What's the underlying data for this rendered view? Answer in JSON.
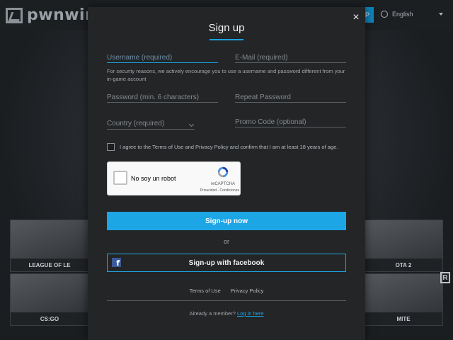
{
  "background": {
    "logo_text": "pwnwin",
    "language": "English",
    "tiles": [
      "LEAGUE OF LE",
      "OTA 2",
      "CS:GO",
      "MITE"
    ],
    "badge_letter": "R"
  },
  "modal": {
    "title": "Sign up",
    "close_label": "×",
    "username_placeholder": "Username (required)",
    "email_placeholder": "E-Mail (required)",
    "security_hint": "For security reasons, we actively encourage you to use a username and password different from your in-game account",
    "password_placeholder": "Password (min. 6 characters)",
    "repeat_password_placeholder": "Repeat Password",
    "country_placeholder": "Country (required)",
    "promo_placeholder": "Promo Code (optional)",
    "agree_text": "I agree to the Terms of Use and Privacy Policy and confirm that I am at least 18 years of age.",
    "recaptcha": {
      "label": "No soy un robot",
      "brand": "reCAPTCHA",
      "links": "Privacidad - Condiciones"
    },
    "signup_button": "Sign-up now",
    "or_text": "or",
    "facebook_button": "Sign-up with facebook",
    "facebook_icon_glyph": "f",
    "terms_link": "Terms of Use",
    "privacy_link": "Privacy Policy",
    "member_text": "Already a member?",
    "login_link": "Log in here"
  },
  "colors": {
    "accent": "#1da6e6",
    "modal_bg": "#232527",
    "facebook": "#3b5998"
  }
}
